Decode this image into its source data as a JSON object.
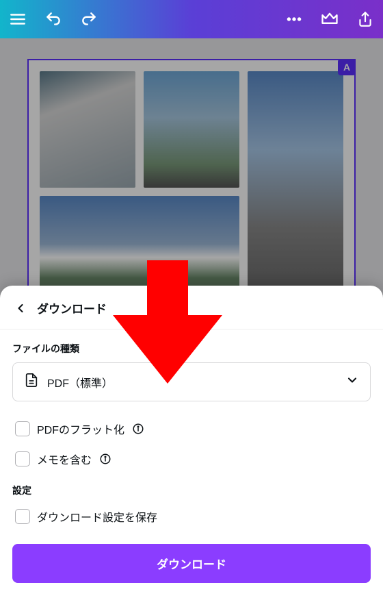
{
  "toolbar": {},
  "canvas": {
    "badge": "A"
  },
  "sheet": {
    "title": "ダウンロード",
    "file_type_section_label": "ファイルの種類",
    "file_type_selected": "PDF（標準）",
    "options": {
      "flatten": {
        "label": "PDFのフラット化",
        "checked": false
      },
      "include_notes": {
        "label": "メモを含む",
        "checked": false
      }
    },
    "settings_section_label": "設定",
    "save_settings": {
      "label": "ダウンロード設定を保存",
      "checked": false
    },
    "download_button": "ダウンロード"
  }
}
